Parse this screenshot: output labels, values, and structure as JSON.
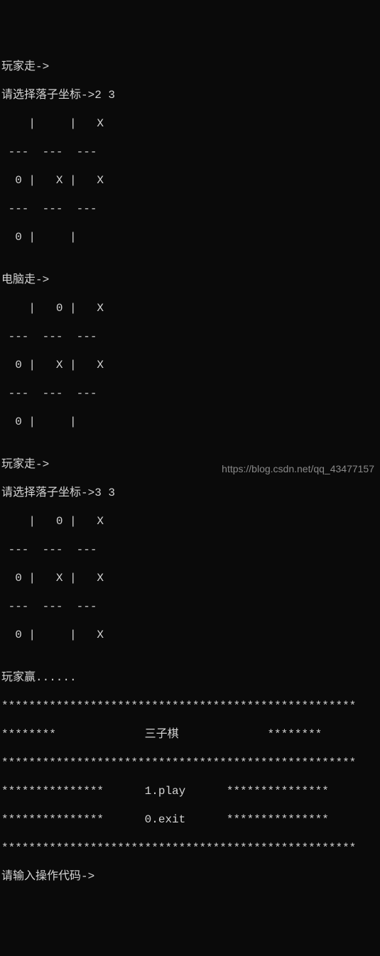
{
  "lines": {
    "l01": "玩家走->",
    "l02": "请选择落子坐标->2 3",
    "l03": "    |     |   X",
    "l04": " ---  ---  ---",
    "l05": "  0 |   X |   X",
    "l06": " ---  ---  ---",
    "l07": "  0 |     |",
    "l08": "",
    "l09": "电脑走->",
    "l10": "    |   0 |   X",
    "l11": " ---  ---  ---",
    "l12": "  0 |   X |   X",
    "l13": " ---  ---  ---",
    "l14": "  0 |     |",
    "l15": "",
    "l16": "玩家走->",
    "l17": "请选择落子坐标->3 3",
    "l18": "    |   0 |   X",
    "l19": " ---  ---  ---",
    "l20": "  0 |   X |   X",
    "l21": " ---  ---  ---",
    "l22": "  0 |     |   X",
    "l23": "",
    "l24": "玩家赢......",
    "l25": "****************************************************",
    "l26": "********             三子棋             ********",
    "l27": "****************************************************",
    "l28": "***************      1.play      ***************",
    "l29": "***************      0.exit      ***************",
    "l30": "****************************************************",
    "l31": "请输入操作代码->"
  },
  "watermark": "https://blog.csdn.net/qq_43477157"
}
